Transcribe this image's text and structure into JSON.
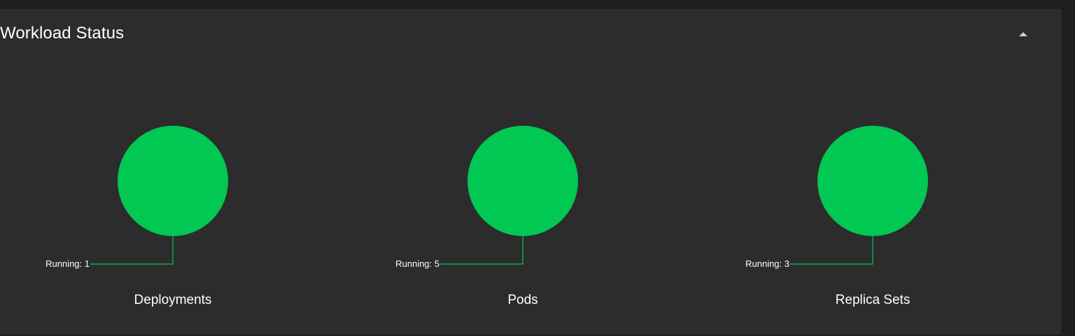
{
  "card": {
    "title": "Workload Status"
  },
  "icons": {
    "collapse": "chevron-up-icon"
  },
  "colors": {
    "page_background": "#1e1e1e",
    "card_background": "#2c2c2c",
    "running": "#00c853",
    "text": "#ffffff"
  },
  "chart_data": [
    {
      "type": "pie",
      "title": "Deployments",
      "slices": [
        {
          "label": "Running",
          "value": 1
        }
      ]
    },
    {
      "type": "pie",
      "title": "Pods",
      "slices": [
        {
          "label": "Running",
          "value": 5
        }
      ]
    },
    {
      "type": "pie",
      "title": "Replica Sets",
      "slices": [
        {
          "label": "Running",
          "value": 3
        }
      ]
    }
  ]
}
